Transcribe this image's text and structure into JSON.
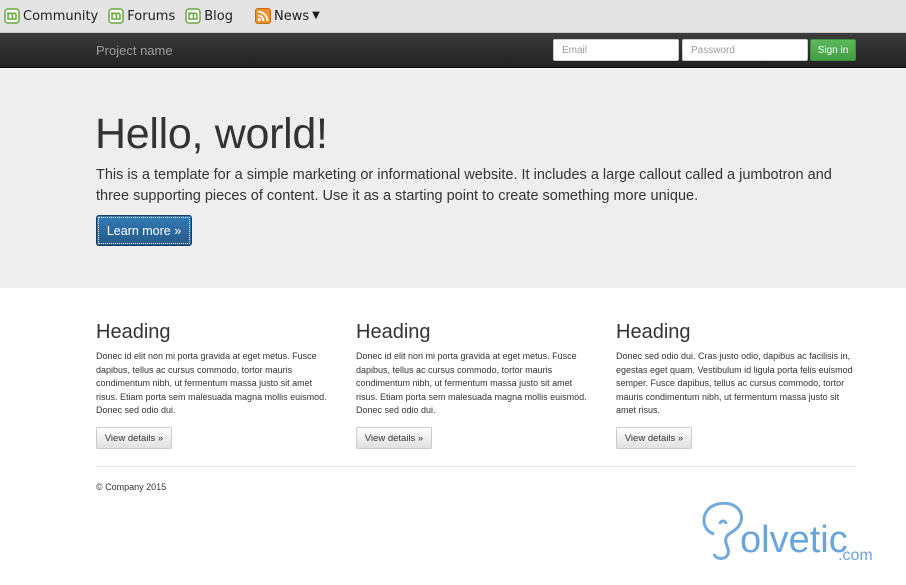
{
  "bookmarks": {
    "items": [
      {
        "label": "Community",
        "icon": "mint-icon"
      },
      {
        "label": "Forums",
        "icon": "mint-icon"
      },
      {
        "label": "Blog",
        "icon": "mint-icon"
      },
      {
        "label": "News",
        "icon": "rss-icon"
      }
    ]
  },
  "navbar": {
    "brand": "Project name",
    "email_placeholder": "Email",
    "password_placeholder": "Password",
    "signin_label": "Sign in"
  },
  "jumbotron": {
    "title": "Hello, world!",
    "text": "This is a template for a simple marketing or informational website. It includes a large callout called a jumbotron and three supporting pieces of content. Use it as a starting point to create something more unique.",
    "button_label": "Learn more »"
  },
  "columns": [
    {
      "heading": "Heading",
      "text": "Donec id elit non mi porta gravida at eget metus. Fusce dapibus, tellus ac cursus commodo, tortor mauris condimentum nibh, ut fermentum massa justo sit amet risus. Etiam porta sem malesuada magna mollis euismod. Donec sed odio dui.",
      "button_label": "View details »"
    },
    {
      "heading": "Heading",
      "text": "Donec id elit non mi porta gravida at eget metus. Fusce dapibus, tellus ac cursus commodo, tortor mauris condimentum nibh, ut fermentum massa justo sit amet risus. Etiam porta sem malesuada magna mollis euismod. Donec sed odio dui.",
      "button_label": "View details »"
    },
    {
      "heading": "Heading",
      "text": "Donec sed odio dui. Cras justo odio, dapibus ac facilisis in, egestas eget quam. Vestibulum id ligula porta felis euismod semper. Fusce dapibus, tellus ac cursus commodo, tortor mauris condimentum nibh, ut fermentum massa justo sit amet risus.",
      "button_label": "View details »"
    }
  ],
  "footer": {
    "text": "© Company 2015"
  },
  "watermark": {
    "text": "olvetic",
    "suffix": ".com"
  },
  "colors": {
    "navbar_bg": "#222222",
    "jumbotron_bg": "#eeeeee",
    "primary": "#337ab7",
    "success": "#5cb85c",
    "watermark": "#5b9bd5"
  }
}
